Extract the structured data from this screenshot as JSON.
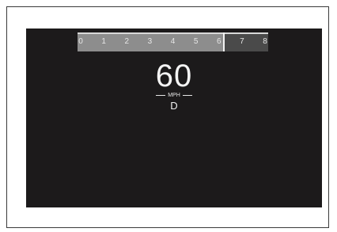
{
  "cluster": {
    "tachometer": {
      "labels": [
        "0",
        "1",
        "2",
        "3",
        "4",
        "5",
        "6",
        "7",
        "8"
      ],
      "max": 8,
      "value": 6.2
    },
    "speed": "60",
    "unit": "MPH",
    "gear": "D"
  },
  "colors": {
    "display_bg": "#1c1a1b",
    "tach_fill": "#8d8d8d",
    "tach_track": "#4a4a4a",
    "text": "#f4f4f4"
  }
}
